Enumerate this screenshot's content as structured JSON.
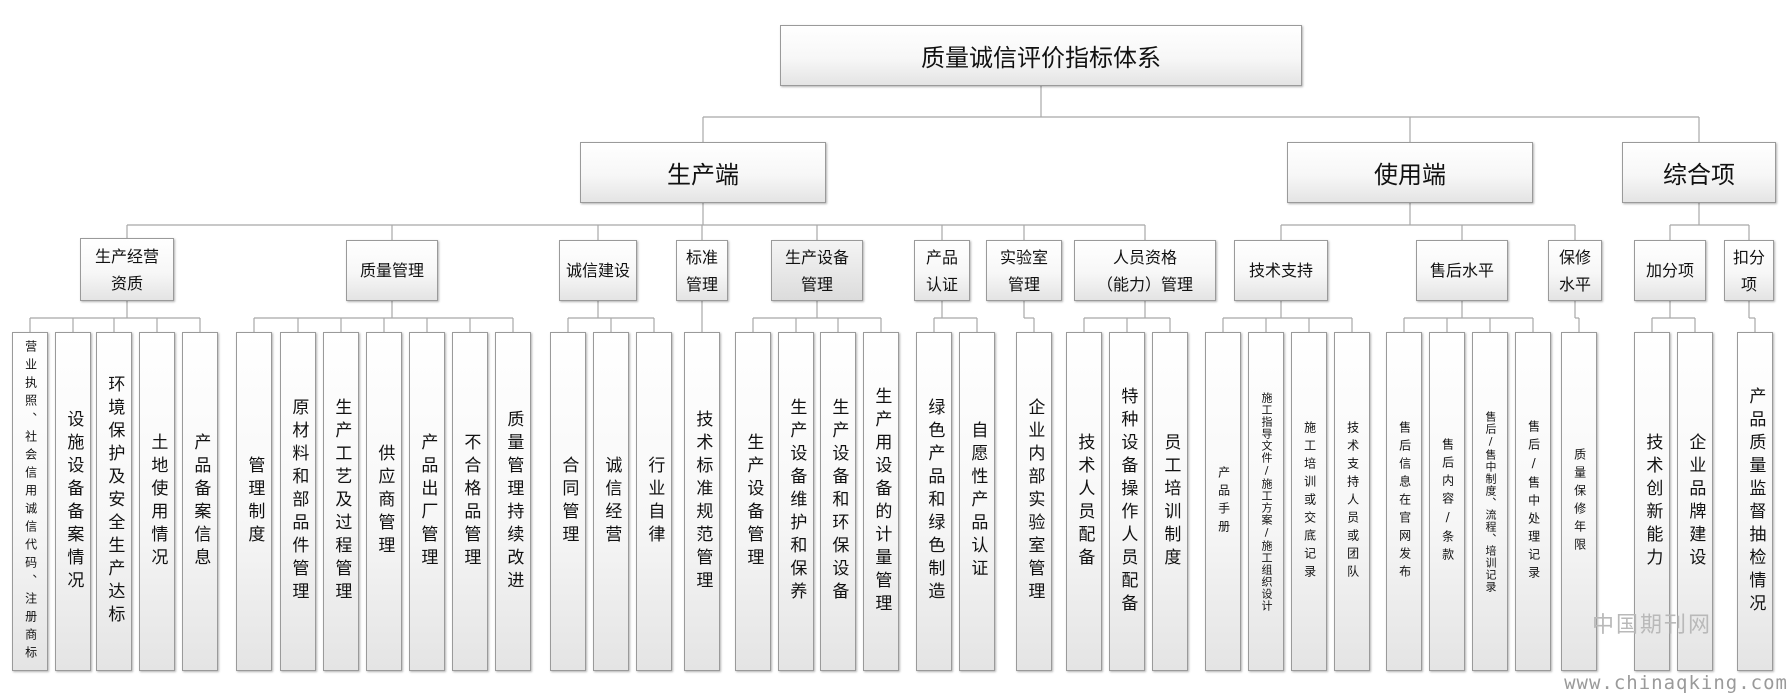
{
  "root": "质量诚信评价指标体系",
  "branches": [
    {
      "label": "生产端",
      "groups": [
        {
          "label": "生产经营\n资质",
          "items": [
            "营业执照、社会信用诚信代码、注册商标",
            "设施设备备案情况",
            "环境保护及安全生产达标",
            "土地使用情况",
            "产品备案信息"
          ]
        },
        {
          "label": "质量管理",
          "items": [
            "管理制度",
            "原材料和部品件管理",
            "生产工艺及过程管理",
            "供应商管理",
            "产品出厂管理",
            "不合格品管理",
            "质量管理持续改进"
          ]
        },
        {
          "label": "诚信建设",
          "items": [
            "合同管理",
            "诚信经营",
            "行业自律"
          ]
        },
        {
          "label": "标准\n管理",
          "items": [
            "技术标准规范管理"
          ]
        },
        {
          "label": "生产设备\n管理",
          "items": [
            "生产设备管理",
            "生产设备维护和保养",
            "生产设备和环保设备",
            "生产用设备的计量管理"
          ]
        },
        {
          "label": "产品\n认证",
          "items": [
            "绿色产品和绿色制造",
            "自愿性产品认证"
          ]
        },
        {
          "label": "实验室\n管理",
          "items": [
            "企业内部实验室管理"
          ]
        },
        {
          "label": "人员资格\n（能力）管理",
          "items": [
            "技术人员配备",
            "特种设备操作人员配备",
            "员工培训制度"
          ]
        }
      ]
    },
    {
      "label": "使用端",
      "groups": [
        {
          "label": "技术支持",
          "items": [
            "产品手册",
            "施工指导文件/施工方案/施工组织设计",
            "施工培训或交底记录",
            "技术支持人员或团队"
          ]
        },
        {
          "label": "售后水平",
          "items": [
            "售后信息在官网发布",
            "售后内容/条款",
            "售后/售中制度、流程、培训记录",
            "售后/售中处理记录"
          ]
        },
        {
          "label": "保修\n水平",
          "items": [
            "质量保修年限"
          ]
        }
      ]
    },
    {
      "label": "综合项",
      "groups": [
        {
          "label": "加分项",
          "items": [
            "技术创新能力",
            "企业品牌建设"
          ]
        },
        {
          "label": "扣分\n项",
          "items": [
            "产品质量监督抽检情况"
          ]
        }
      ]
    }
  ],
  "watermark": {
    "name": "中国期刊网",
    "url": "www.chinaqking.com"
  },
  "colors": {
    "border": "#9a9a9a",
    "connector": "#a8a8a8",
    "fill_top": "#ffffff",
    "fill_bottom": "#e4e4e4"
  }
}
